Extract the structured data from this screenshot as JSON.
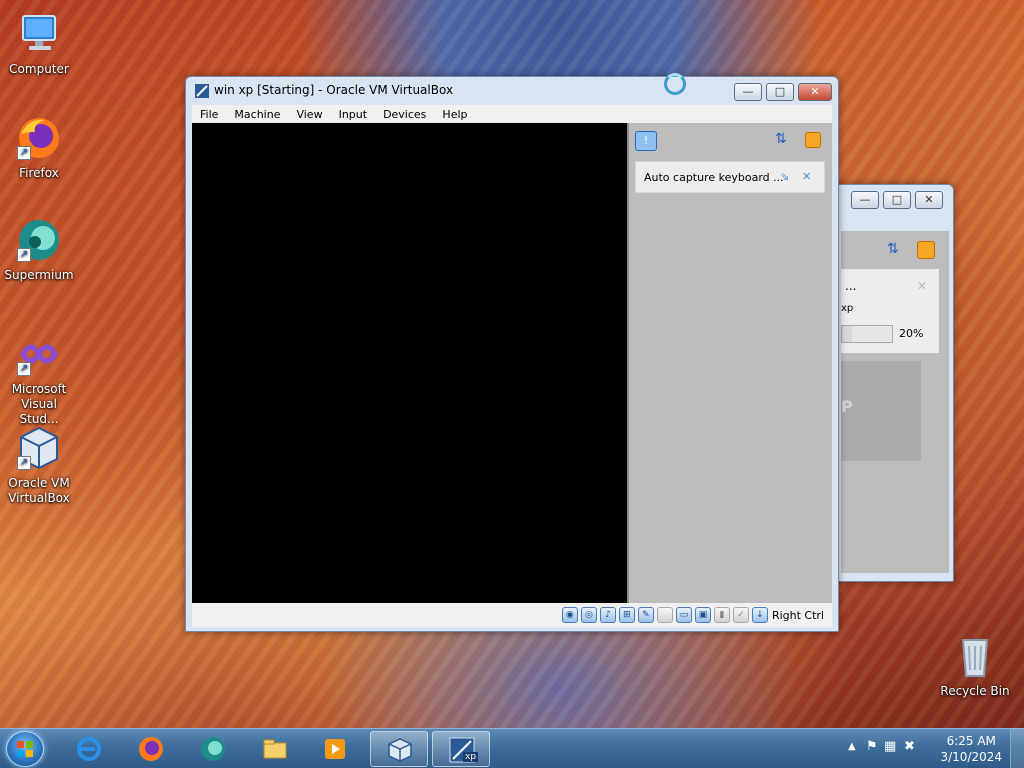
{
  "desktop": {
    "icons": [
      {
        "label": "Computer",
        "icon": "computer-icon"
      },
      {
        "label": "Firefox",
        "icon": "firefox-icon"
      },
      {
        "label": "Supermium",
        "icon": "supermium-icon"
      },
      {
        "label": "Microsoft Visual Stud...",
        "icon": "visual-studio-icon"
      },
      {
        "label": "Oracle VM VirtualBox",
        "icon": "virtualbox-icon"
      },
      {
        "label": "Recycle Bin",
        "icon": "recycle-bin-icon"
      }
    ]
  },
  "vm_window": {
    "title": "win xp [Starting] - Oracle VM VirtualBox",
    "menu": [
      "File",
      "Machine",
      "View",
      "Input",
      "Devices",
      "Help"
    ],
    "notification": {
      "text": "Auto capture keyboard ..."
    },
    "status": {
      "host_key": "Right Ctrl"
    }
  },
  "background_window": {
    "notification_title": "...",
    "notification_sub": "xp",
    "progress_percent": 20,
    "progress_label": "20%",
    "preview_text": "P"
  },
  "taskbar": {
    "apps": [
      "internet-explorer-icon",
      "firefox-icon",
      "supermium-icon",
      "file-explorer-icon",
      "media-player-icon",
      "virtualbox-icon",
      "virtualbox-vm-icon"
    ],
    "vm_badge": "xp",
    "time": "6:25 AM",
    "date": "3/10/2024"
  },
  "colors": {
    "accent": "#2f77c0",
    "close": "#c74a34",
    "taskbar": "#3e6d9b"
  }
}
